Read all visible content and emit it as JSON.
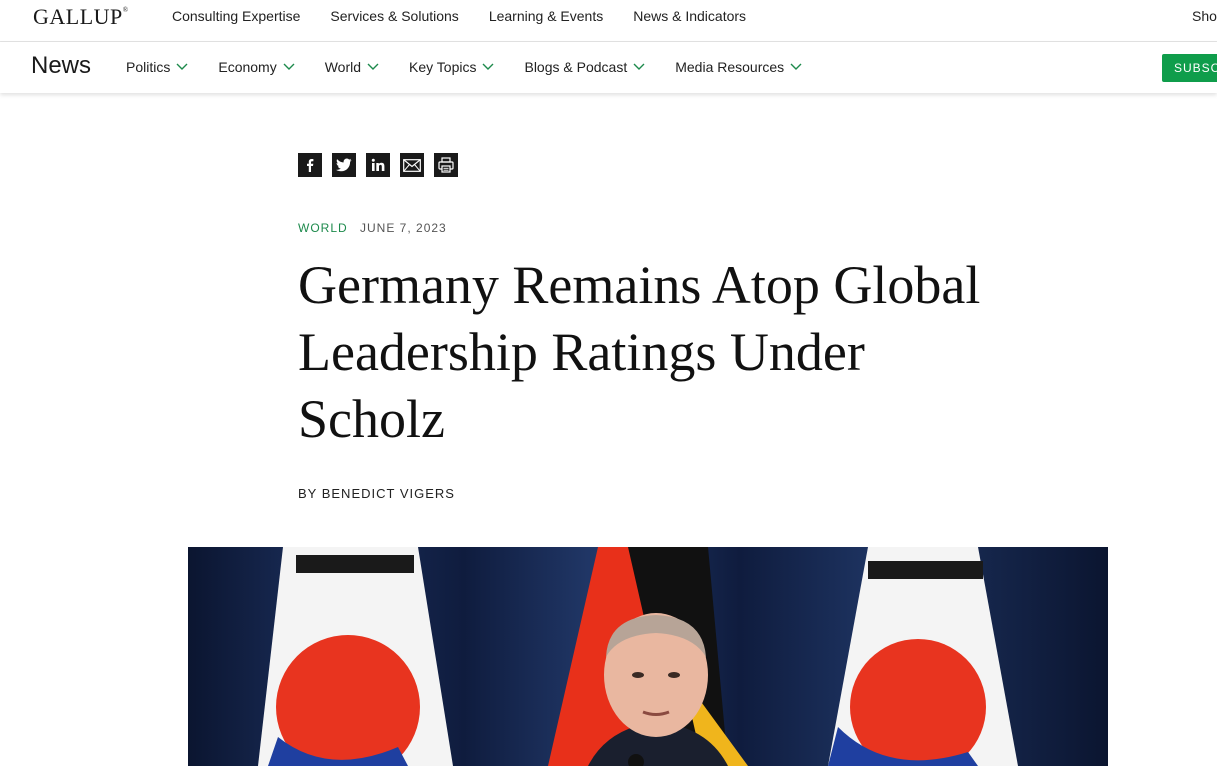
{
  "brand": {
    "logo": "GALLUP",
    "reg": "®"
  },
  "top_nav": {
    "items": [
      "Consulting Expertise",
      "Services & Solutions",
      "Learning & Events",
      "News & Indicators"
    ],
    "right": "Sho"
  },
  "section_nav": {
    "title": "News",
    "items": [
      "Politics",
      "Economy",
      "World",
      "Key Topics",
      "Blogs & Podcast",
      "Media Resources"
    ],
    "subscribe": "SUBSCRIBE"
  },
  "share_icons": [
    "facebook-icon",
    "twitter-icon",
    "linkedin-icon",
    "email-icon",
    "print-icon"
  ],
  "article": {
    "category": "WORLD",
    "date": "JUNE 7, 2023",
    "headline_lines": [
      "Germany Remains Atop Global",
      "Leadership Ratings Under",
      "Scholz"
    ],
    "byline": "BY BENEDICT VIGERS"
  },
  "colors": {
    "accent_green": "#0f9d4b",
    "category_green": "#1d8a4c"
  }
}
